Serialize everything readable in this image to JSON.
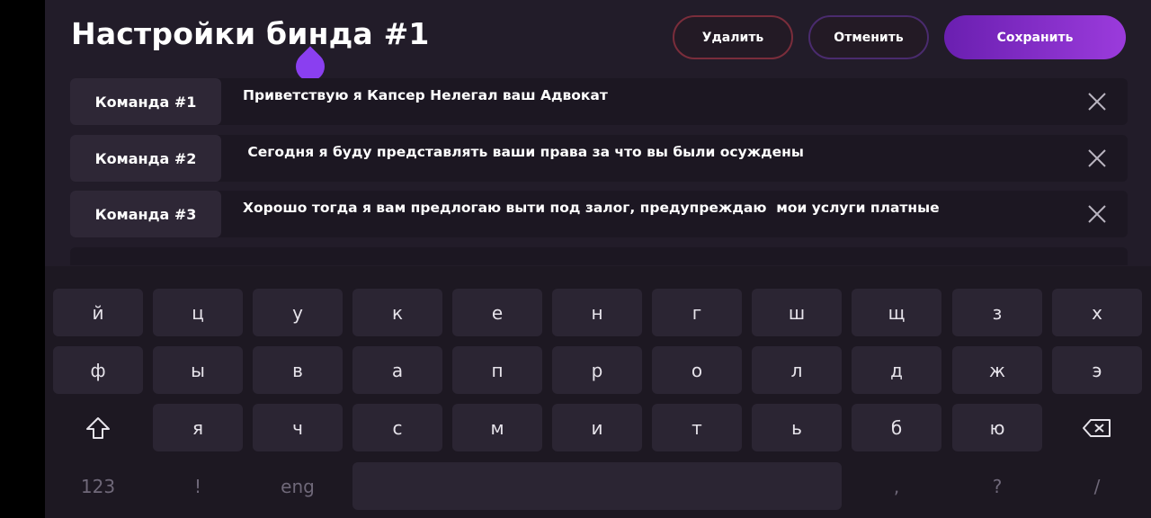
{
  "header": {
    "title": "Настройки бинда #1",
    "delete_label": "Удалить",
    "cancel_label": "Отменить",
    "save_label": "Сохранить"
  },
  "commands": [
    {
      "label": "Команда #1",
      "text": "Приветствую я Капсер Нелегал ваш Адвокат"
    },
    {
      "label": "Команда #2",
      "text": " Сегодня я буду представлять ваши права за что вы были осуждены"
    },
    {
      "label": "Команда #3",
      "text": "Хорошо тогда я вам предлогаю выти под залог, предупреждаю  мои услуги платные"
    }
  ],
  "keyboard": {
    "row1": [
      "й",
      "ц",
      "у",
      "к",
      "е",
      "н",
      "г",
      "ш",
      "щ",
      "з",
      "х"
    ],
    "row2": [
      "ф",
      "ы",
      "в",
      "а",
      "п",
      "р",
      "о",
      "л",
      "д",
      "ж",
      "э"
    ],
    "row3": [
      "я",
      "ч",
      "с",
      "м",
      "и",
      "т",
      "ь",
      "б",
      "ю"
    ],
    "numbers_label": "123",
    "exclamation": "!",
    "language_label": "eng",
    "comma": ",",
    "question": "?",
    "slash": "/",
    "shift_icon": "shift-icon",
    "backspace_icon": "backspace-icon"
  },
  "colors": {
    "background": "#221c29",
    "accent": "#8a3ff0",
    "delete_border": "#7a2d3b",
    "cancel_border": "#4a2b6e"
  }
}
